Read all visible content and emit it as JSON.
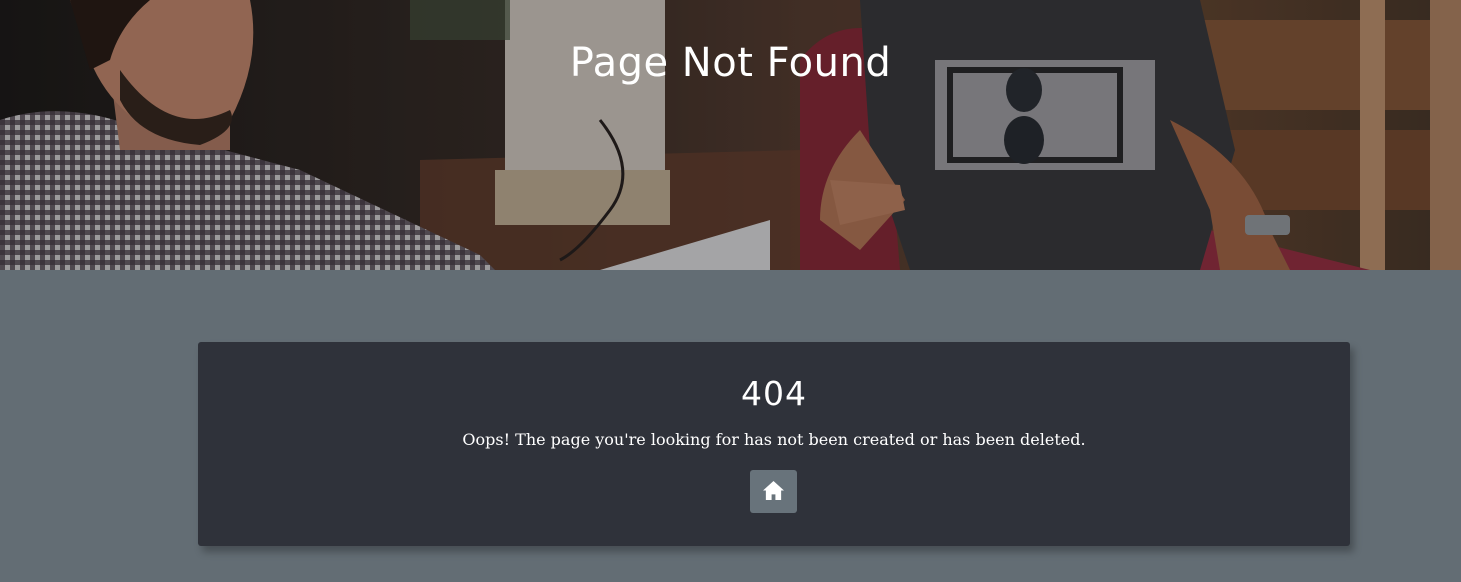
{
  "hero": {
    "title": "Page Not Found"
  },
  "error": {
    "code": "404",
    "message": "Oops! The page you're looking for has not been created or has been deleted.",
    "home_button_icon": "home-icon"
  },
  "colors": {
    "page_background": "#636d74",
    "card_background": "#2f323a",
    "button_background": "#68737b",
    "text": "#ffffff"
  }
}
